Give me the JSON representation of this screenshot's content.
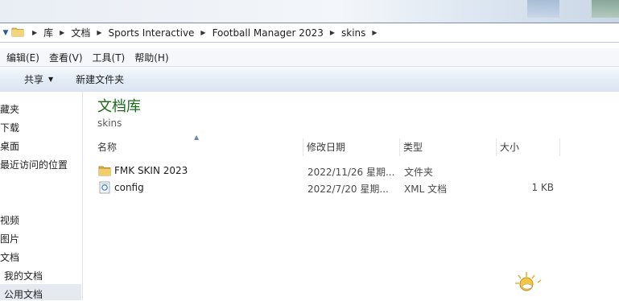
{
  "address_bar": {
    "breadcrumbs": [
      "库",
      "文档",
      "Sports Interactive",
      "Football Manager 2023",
      "skins"
    ]
  },
  "menu": {
    "edit": "编辑(E)",
    "view": "查看(V)",
    "tools": "工具(T)",
    "help": "帮助(H)"
  },
  "toolbar": {
    "share": "共享",
    "new_folder": "新建文件夹"
  },
  "nav": {
    "items": [
      "藏夹",
      "下载",
      "桌面",
      "最近访问的位置",
      "视频",
      "图片",
      "文档",
      "我的文档",
      "公用文档"
    ]
  },
  "library": {
    "title": "文档库",
    "subtitle": "skins"
  },
  "columns": {
    "name": "名称",
    "modified": "修改日期",
    "type": "类型",
    "size": "大小"
  },
  "files": [
    {
      "name": "FMK SKIN 2023",
      "modified": "2022/11/26 星期...",
      "type": "文件夹",
      "size": "",
      "icon": "folder-icon"
    },
    {
      "name": "config",
      "modified": "2022/7/20 星期...",
      "type": "XML 文档",
      "size": "1 KB",
      "icon": "xml-file-icon"
    }
  ],
  "colors": {
    "library_title": "#1a6a1a",
    "toolbar_bg": "#dbe5f1"
  }
}
